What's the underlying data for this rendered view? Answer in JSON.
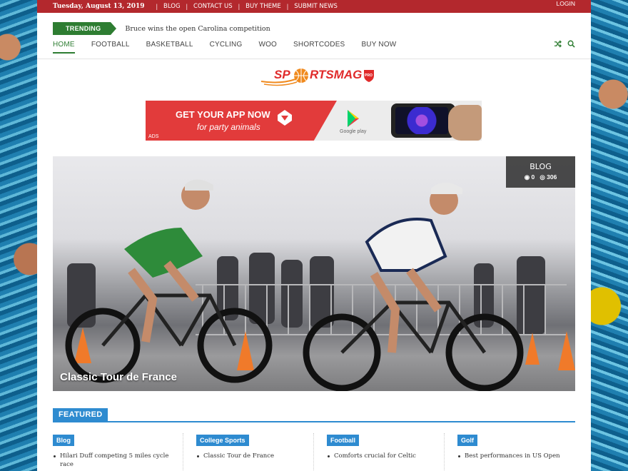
{
  "topbar": {
    "date": "Tuesday, August 13, 2019",
    "links": [
      "BLOG",
      "CONTACT US",
      "BUY THEME",
      "SUBMIT NEWS"
    ],
    "login": "LOGIN"
  },
  "trending": {
    "label": "TRENDING",
    "headline": "Bruce wins the open Carolina competition"
  },
  "nav": {
    "items": [
      "HOME",
      "FOOTBALL",
      "BASKETBALL",
      "CYCLING",
      "WOO",
      "SHORTCODES",
      "BUY NOW"
    ],
    "active": "HOME",
    "icons": [
      "shuffle-icon",
      "search-icon"
    ]
  },
  "logo": {
    "text_left": "SP",
    "text_right": "RTSMAG",
    "badge": "PRO"
  },
  "ad": {
    "title": "GET YOUR APP NOW",
    "subtitle": "for party animals",
    "label": "ADS",
    "store": "Google play"
  },
  "hero": {
    "title": "Classic Tour de France",
    "category": "BLOG",
    "comments": "0",
    "views": "306"
  },
  "featured": {
    "label": "FEATURED",
    "columns": [
      {
        "category": "Blog",
        "items": [
          "Hilari Duff competing 5 miles cycle race"
        ]
      },
      {
        "category": "College Sports",
        "items": [
          "Classic Tour de France"
        ]
      },
      {
        "category": "Football",
        "items": [
          "Comforts crucial for Celtic"
        ]
      },
      {
        "category": "Golf",
        "items": [
          "Best performances in US Open"
        ]
      }
    ]
  },
  "colors": {
    "topbar": "#b3282d",
    "accent_green": "#2e7d32",
    "accent_blue": "#2e8bd0",
    "logo_red": "#e02b2b",
    "logo_orange": "#f08a1e"
  }
}
